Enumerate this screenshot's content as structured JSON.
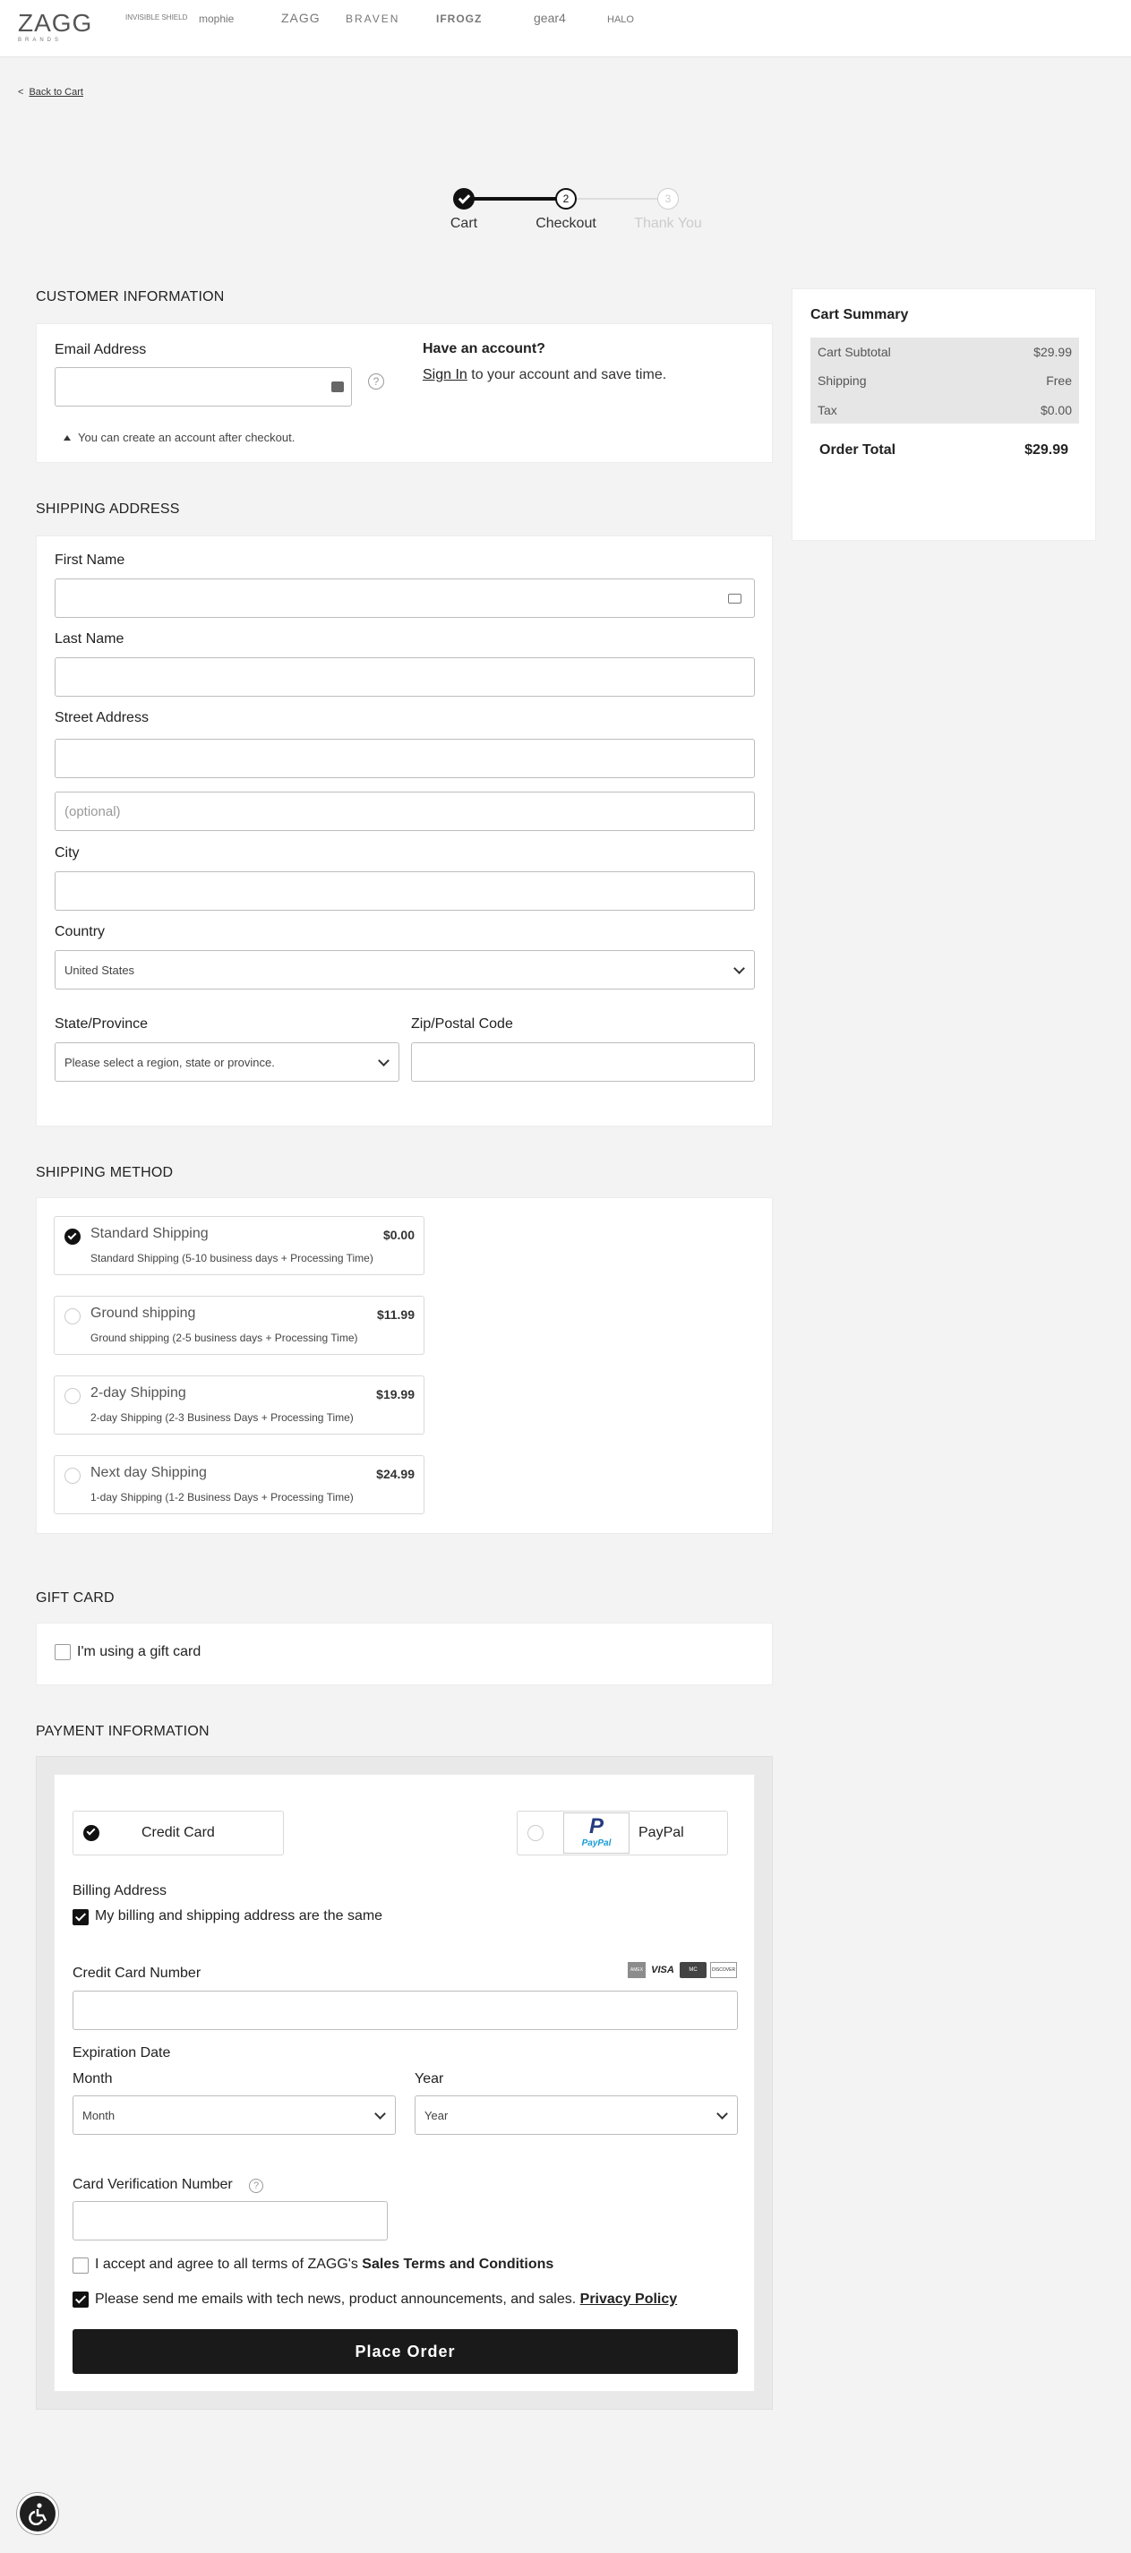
{
  "header": {
    "logo_main": "ZAGG",
    "logo_sub": "BRANDS",
    "brands": [
      "INVISIBLE SHIELD",
      "mophie",
      "ZAGG",
      "BRAVEN",
      "IFROGZ",
      "gear4",
      "HALO"
    ]
  },
  "nav": {
    "back_link": "Back to Cart",
    "back_chevron": "<"
  },
  "progress": {
    "steps": [
      {
        "label": "Cart",
        "number": "1",
        "state": "done"
      },
      {
        "label": "Checkout",
        "number": "2",
        "state": "current"
      },
      {
        "label": "Thank You",
        "number": "3",
        "state": "future"
      }
    ]
  },
  "customer": {
    "title": "CUSTOMER INFORMATION",
    "email_label": "Email Address",
    "email_value": "",
    "help": "?",
    "have_account": "Have an account?",
    "sign_in": "Sign In",
    "sign_in_rest": " to your account and save time.",
    "note": "You can create an account after checkout."
  },
  "shipping_address": {
    "title": "SHIPPING ADDRESS",
    "first_name_label": "First Name",
    "last_name_label": "Last Name",
    "street_label": "Street Address",
    "street2_placeholder": "(optional)",
    "city_label": "City",
    "country_label": "Country",
    "country_value": "United States",
    "state_label": "State/Province",
    "state_value": "Please select a region, state or province.",
    "zip_label": "Zip/Postal Code"
  },
  "shipping_method": {
    "title": "SHIPPING METHOD",
    "options": [
      {
        "name": "Standard Shipping",
        "price": "$0.00",
        "desc": "Standard Shipping (5-10 business days + Processing Time)",
        "selected": true
      },
      {
        "name": "Ground shipping",
        "price": "$11.99",
        "desc": "Ground shipping (2-5 business days + Processing Time)",
        "selected": false
      },
      {
        "name": "2-day Shipping",
        "price": "$19.99",
        "desc": "2-day Shipping (2-3 Business Days + Processing Time)",
        "selected": false
      },
      {
        "name": "Next day Shipping",
        "price": "$24.99",
        "desc": "1-day Shipping (1-2 Business Days + Processing Time)",
        "selected": false
      }
    ]
  },
  "gift_card": {
    "title": "GIFT CARD",
    "checkbox_label": "I'm using a gift card",
    "checked": false
  },
  "payment": {
    "title": "PAYMENT INFORMATION",
    "credit_card_label": "Credit Card",
    "credit_card_selected": true,
    "paypal_label": "PayPal",
    "paypal_logo": "PayPal",
    "billing_title": "Billing Address",
    "billing_same_label": "My billing and shipping address are the same",
    "billing_same_checked": true,
    "cc_number_label": "Credit Card Number",
    "card_brands": [
      "AMEX",
      "VISA",
      "MC",
      "DISCOVER"
    ],
    "expiration_label": "Expiration Date",
    "month_label": "Month",
    "month_value": "Month",
    "year_label": "Year",
    "year_value": "Year",
    "cvv_label": "Card Verification Number",
    "terms_prefix": "I accept and agree to all terms of ZAGG's ",
    "terms_link": "Sales Terms and Conditions",
    "terms_checked": false,
    "emails_prefix": "Please send me emails with tech news, product announcements, and sales. ",
    "emails_link": "Privacy Policy",
    "emails_checked": true,
    "place_order": "Place Order"
  },
  "summary": {
    "title": "Cart Summary",
    "rows": [
      {
        "label": "Cart Subtotal",
        "value": "$29.99"
      },
      {
        "label": "Shipping",
        "value": "Free"
      },
      {
        "label": "Tax",
        "value": "$0.00"
      }
    ],
    "total_label": "Order Total",
    "total_value": "$29.99"
  },
  "colors": {
    "accent": "#111111",
    "background": "#f3f3f3",
    "summary_rows_bg": "#e6e6e6"
  }
}
